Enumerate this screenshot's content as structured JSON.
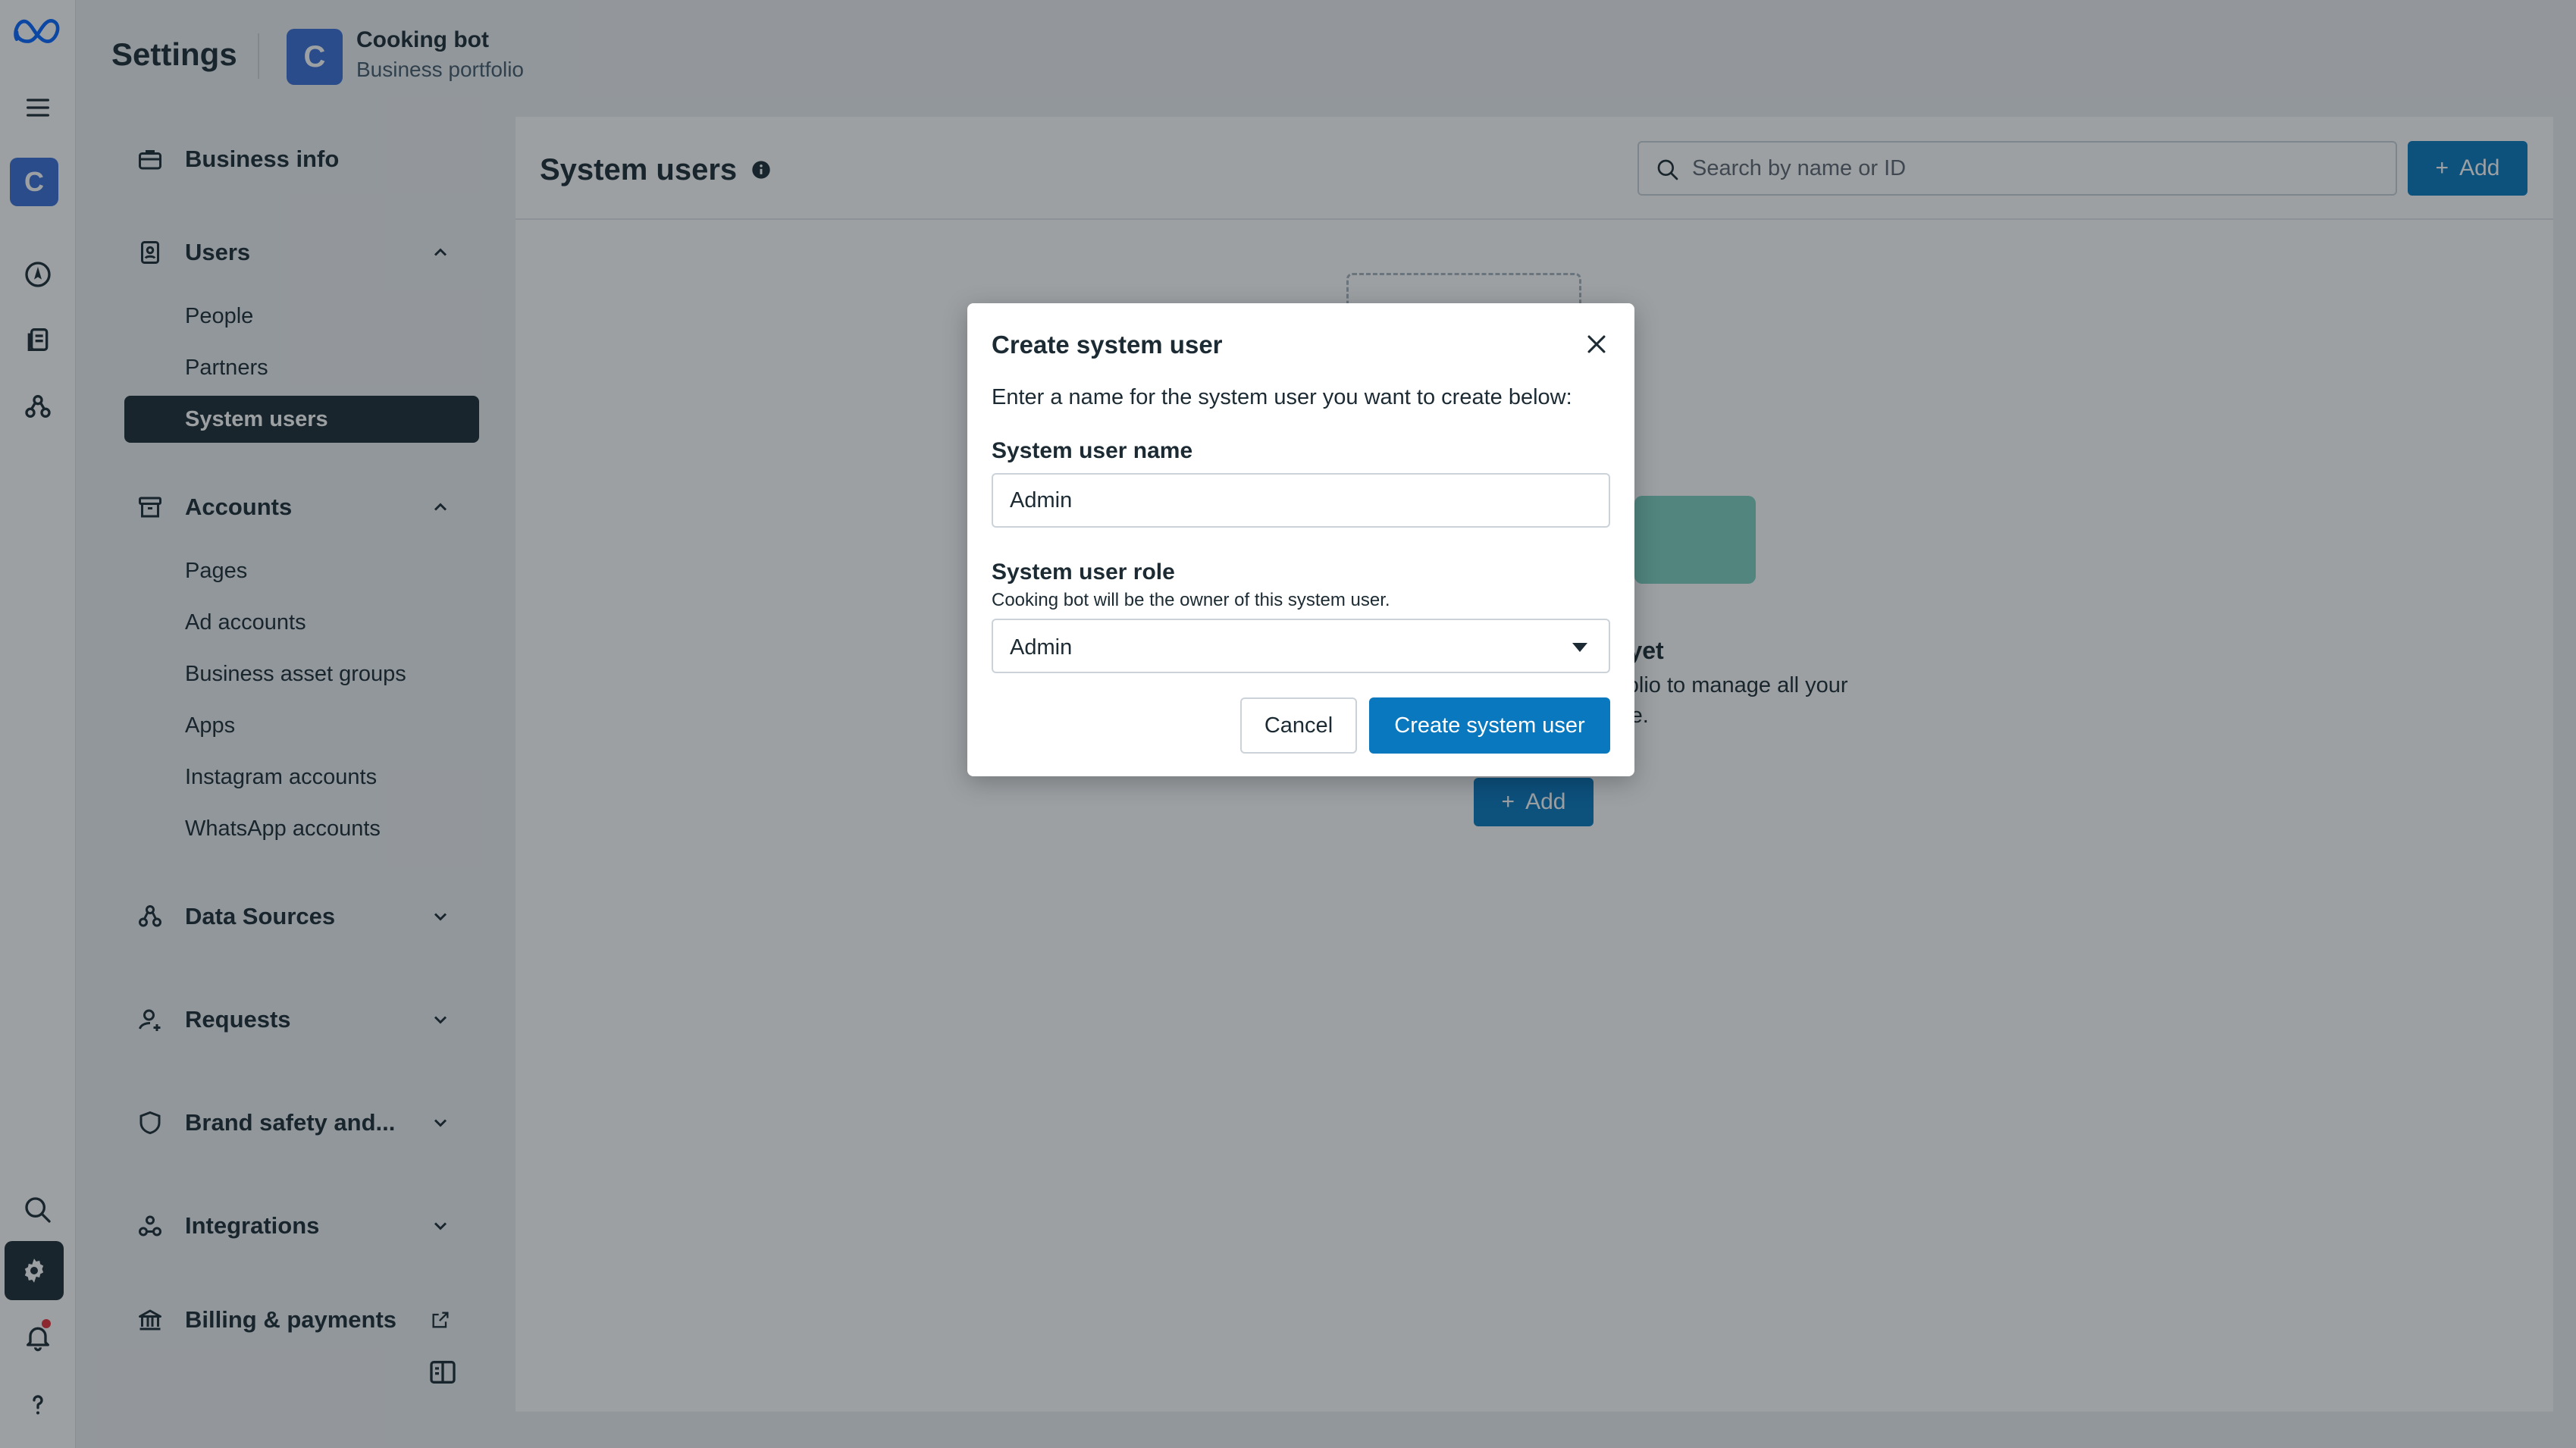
{
  "rail": {
    "account_initial": "C",
    "icons": [
      "meta-logo-icon",
      "menu-icon",
      "account-avatar",
      "compass-icon",
      "documents-icon",
      "data-sources-icon",
      "search-icon",
      "settings-icon",
      "notifications-icon",
      "help-icon"
    ]
  },
  "header": {
    "title": "Settings",
    "business_initial": "C",
    "business_name": "Cooking bot",
    "business_subtitle": "Business portfolio"
  },
  "sidebar": {
    "business_info": "Business info",
    "users": {
      "label": "Users",
      "items": [
        "People",
        "Partners",
        "System users"
      ]
    },
    "accounts": {
      "label": "Accounts",
      "items": [
        "Pages",
        "Ad accounts",
        "Business asset groups",
        "Apps",
        "Instagram accounts",
        "WhatsApp accounts"
      ]
    },
    "data_sources": "Data Sources",
    "requests": "Requests",
    "brand_safety": "Brand safety and...",
    "integrations": "Integrations",
    "billing": "Billing & payments"
  },
  "main": {
    "title": "System users",
    "search_placeholder": "Search by name or ID",
    "add_label": "Add",
    "empty_title_fragment": "d yet",
    "empty_desc_line1": "rtfolio to manage all your",
    "empty_desc_line2": "ace.",
    "empty_add_label": "Add"
  },
  "modal": {
    "title": "Create system user",
    "description": "Enter a name for the system user you want to create below:",
    "name_label": "System user name",
    "name_value": "Admin",
    "role_label": "System user role",
    "role_hint": "Cooking bot will be the owner of this system user.",
    "role_value": "Admin",
    "cancel_label": "Cancel",
    "create_label": "Create system user"
  },
  "colors": {
    "primary": "#0a78be",
    "dark": "#1c2b33",
    "avatar": "#3b6fd6",
    "notification": "#e4333a"
  }
}
